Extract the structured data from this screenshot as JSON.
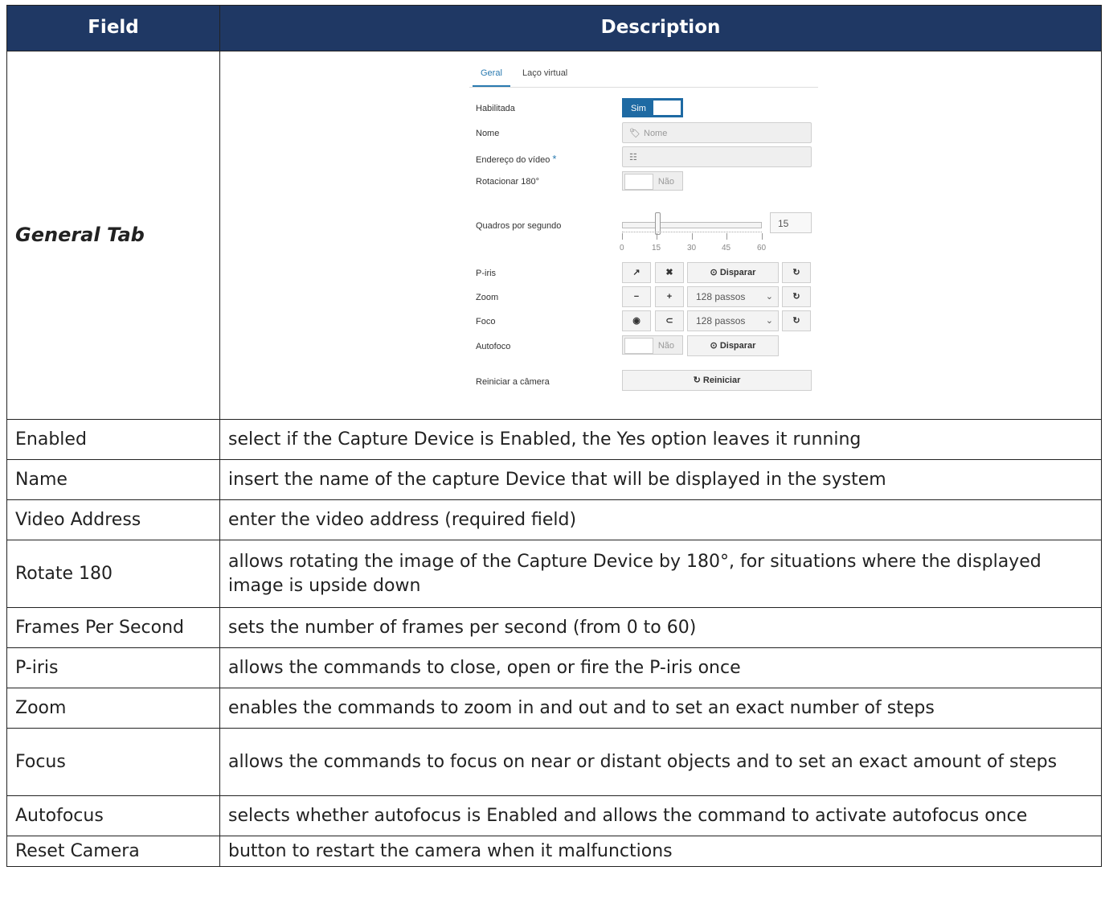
{
  "table": {
    "header_field": "Field",
    "header_description": "Description",
    "general_tab_label": "General Tab",
    "rows": [
      {
        "field": "Enabled",
        "description": "select if the Capture Device is Enabled, the Yes option leaves it running"
      },
      {
        "field": "Name",
        "description": "insert the name of the capture Device that will be displayed in the system"
      },
      {
        "field": "Video Address",
        "description": "enter the video address (required field)"
      },
      {
        "field": "Rotate 180",
        "description": "allows rotating the image of the Capture Device by 180°, for situations where the displayed image is upside down"
      },
      {
        "field": "Frames Per Second",
        "description": "sets the number of frames per second (from 0 to 60)"
      },
      {
        "field": "P-iris",
        "description": "allows the commands to close, open or fire the P-iris once"
      },
      {
        "field": "Zoom",
        "description": "enables the commands to zoom in and out and to set an exact number of steps"
      },
      {
        "field": "Focus",
        "description": "allows the commands to focus on near or distant objects and to set an exact amount of steps"
      },
      {
        "field": "Autofocus",
        "description": "selects whether autofocus is Enabled and allows the command to activate autofocus once"
      },
      {
        "field": "Reset Camera",
        "description": "button to restart the camera when it malfunctions"
      }
    ]
  },
  "ui": {
    "tabs": [
      "Geral",
      "Laço virtual"
    ],
    "labels": {
      "habilitada": "Habilitada",
      "nome": "Nome",
      "endereco": "Endereço do vídeo",
      "required_mark": "*",
      "rotacionar": "Rotacionar 180°",
      "quadros": "Quadros por segundo",
      "piris": "P-iris",
      "zoom": "Zoom",
      "foco": "Foco",
      "autofoco": "Autofoco",
      "reiniciar": "Reiniciar a câmera"
    },
    "toggle_yes": "Sim",
    "toggle_no": "Não",
    "name_placeholder": "Nome",
    "fps_value": "15",
    "fps_fraction": 0.25,
    "slider_ticks": [
      "0",
      "15",
      "30",
      "45",
      "60"
    ],
    "disparar": "Disparar",
    "steps_option": "128 passos",
    "reiniciar_button": "Reiniciar",
    "icons": {
      "tag": "tag-icon",
      "sitemap": "sitemap-icon",
      "compress": "compress-icon",
      "expand": "expand-icon",
      "target": "target-icon",
      "refresh": "refresh-icon",
      "minus": "minus-icon",
      "plus": "plus-icon",
      "eye": "eye-icon",
      "magnet": "magnet-icon",
      "restart": "restart-icon"
    }
  }
}
